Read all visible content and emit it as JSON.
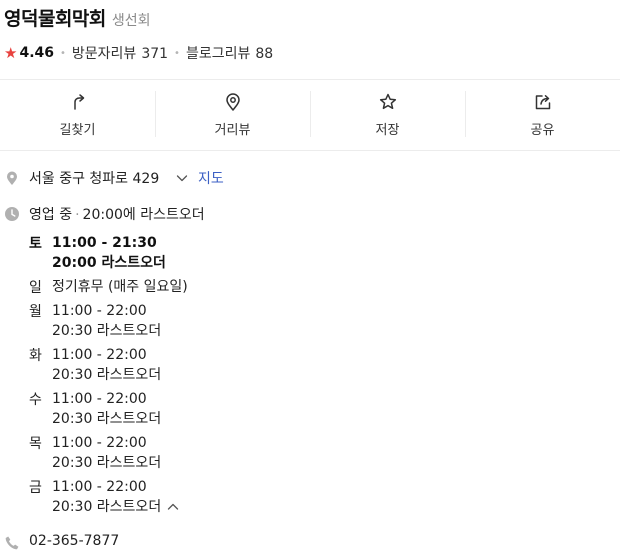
{
  "place": {
    "name": "영덕물회막회",
    "category": "생선회",
    "rating": "4.46",
    "visitor_review_label": "방문자리뷰",
    "visitor_review_count": "371",
    "blog_review_label": "블로그리뷰",
    "blog_review_count": "88"
  },
  "actions": [
    {
      "label": "길찾기",
      "icon": "directions-icon"
    },
    {
      "label": "거리뷰",
      "icon": "location-pin-icon"
    },
    {
      "label": "저장",
      "icon": "star-outline-icon"
    },
    {
      "label": "공유",
      "icon": "share-icon"
    }
  ],
  "address": {
    "text": "서울 중구 청파로 429",
    "map_link": "지도"
  },
  "hours": {
    "status": "영업 중",
    "summary": "20:00에 라스트오더",
    "days": [
      {
        "day": "토",
        "lines": [
          "11:00 - 21:30",
          "20:00 라스트오더"
        ],
        "today": true
      },
      {
        "day": "일",
        "lines": [
          "정기휴무 (매주 일요일)"
        ],
        "today": false
      },
      {
        "day": "월",
        "lines": [
          "11:00 - 22:00",
          "20:30 라스트오더"
        ],
        "today": false
      },
      {
        "day": "화",
        "lines": [
          "11:00 - 22:00",
          "20:30 라스트오더"
        ],
        "today": false
      },
      {
        "day": "수",
        "lines": [
          "11:00 - 22:00",
          "20:30 라스트오더"
        ],
        "today": false
      },
      {
        "day": "목",
        "lines": [
          "11:00 - 22:00",
          "20:30 라스트오더"
        ],
        "today": false
      },
      {
        "day": "금",
        "lines": [
          "11:00 - 22:00",
          "20:30 라스트오더"
        ],
        "today": false
      }
    ]
  },
  "phone": "02-365-7877",
  "colors": {
    "star": "#e8423f",
    "link": "#3b5fc4",
    "muted": "#8a8a8a",
    "icon": "#b0b0b0"
  }
}
